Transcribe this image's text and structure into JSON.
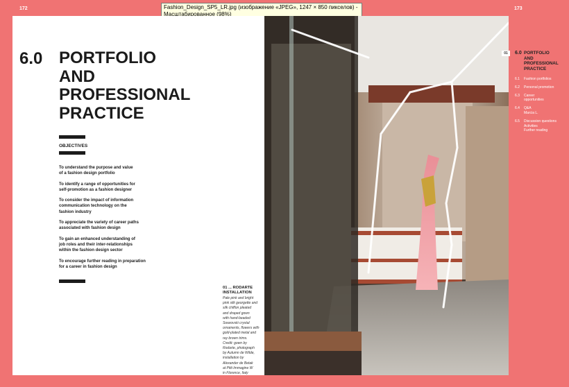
{
  "window": {
    "tooltip_line1": "Fashion_Design_SP5_LR.jpg (изображение «JPEG», 1247 × 850 пикселов) -",
    "tooltip_line2": "Масштабированное (98%)"
  },
  "page_numbers": {
    "left": "172",
    "right": "173"
  },
  "chapter": {
    "number": "6.0",
    "title_lines": [
      "PORTFOLIO",
      "AND",
      "PROFESSIONAL",
      "PRACTICE"
    ]
  },
  "objectives": {
    "heading": "OBJECTIVES",
    "items": [
      [
        "To understand the purpose and value",
        "of a fashion design portfolio"
      ],
      [
        "To identify a range of opportunities for",
        "self-promotion as a fashion designer"
      ],
      [
        "To consider the impact of information",
        "communication technology on the",
        "fashion industry"
      ],
      [
        "To appreciate the variety of career paths",
        "associated with fashion design"
      ],
      [
        "To gain an enhanced understanding of",
        "job roles and their inter-relationships",
        "within the fashion design sector"
      ],
      [
        "To encourage further reading in preparation",
        "for a career in fashion design"
      ]
    ]
  },
  "caption": {
    "title_lines": [
      "01 ... RODARTE",
      "INSTALLATION"
    ],
    "body_lines": [
      "Pale pink and bright",
      "pink silk georgette and",
      "silk chiffon pleated",
      "and draped gown",
      "with hand-beaded",
      "Swarovski crystal",
      "ornaments, flowers with",
      "gold-plated metal and",
      "ray brown trims.",
      "Credit: gown by",
      "Rodarte, photograph",
      "by Autumn de Wilde,",
      "installation by",
      "Alexander de Betak",
      "at Pitti Immagine W",
      "in Florence, Italy"
    ]
  },
  "toc": {
    "chip": "01",
    "number": "6.0",
    "title_lines": [
      "PORTFOLIO",
      "AND",
      "PROFESSIONAL",
      "PRACTICE"
    ],
    "items": [
      {
        "num": "6.1",
        "lines": [
          "Fashion portfolios"
        ]
      },
      {
        "num": "6.2",
        "lines": [
          "Personal promotion"
        ]
      },
      {
        "num": "6.3",
        "lines": [
          "Career",
          "opportunities"
        ]
      },
      {
        "num": "6.4",
        "lines": [
          "Q&A",
          "Marcia L."
        ]
      },
      {
        "num": "6.5",
        "lines": [
          "Discussion questions",
          "Activities",
          "Further reading"
        ]
      }
    ]
  },
  "colors": {
    "background": "#f07373",
    "page": "#ffffff",
    "ink": "#1b1b1b",
    "gown": "#f19aa0",
    "gold": "#c9a23a"
  }
}
